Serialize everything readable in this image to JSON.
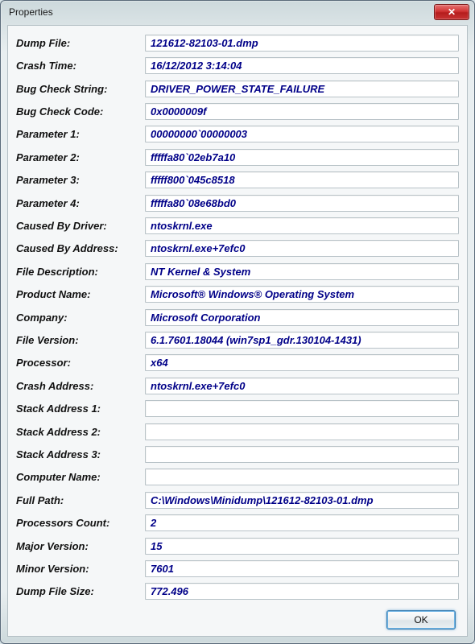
{
  "window": {
    "title": "Properties"
  },
  "fields": [
    {
      "label": "Dump File:",
      "value": "121612-82103-01.dmp"
    },
    {
      "label": "Crash Time:",
      "value": "16/12/2012 3:14:04"
    },
    {
      "label": "Bug Check String:",
      "value": "DRIVER_POWER_STATE_FAILURE"
    },
    {
      "label": "Bug Check Code:",
      "value": "0x0000009f"
    },
    {
      "label": "Parameter 1:",
      "value": "00000000`00000003"
    },
    {
      "label": "Parameter 2:",
      "value": "fffffa80`02eb7a10"
    },
    {
      "label": "Parameter 3:",
      "value": "fffff800`045c8518"
    },
    {
      "label": "Parameter 4:",
      "value": "fffffa80`08e68bd0"
    },
    {
      "label": "Caused By Driver:",
      "value": "ntoskrnl.exe"
    },
    {
      "label": "Caused By Address:",
      "value": "ntoskrnl.exe+7efc0"
    },
    {
      "label": "File Description:",
      "value": "NT Kernel & System"
    },
    {
      "label": "Product Name:",
      "value": "Microsoft® Windows® Operating System"
    },
    {
      "label": "Company:",
      "value": "Microsoft Corporation"
    },
    {
      "label": "File Version:",
      "value": "6.1.7601.18044 (win7sp1_gdr.130104-1431)"
    },
    {
      "label": "Processor:",
      "value": "x64"
    },
    {
      "label": "Crash Address:",
      "value": "ntoskrnl.exe+7efc0"
    },
    {
      "label": "Stack Address 1:",
      "value": ""
    },
    {
      "label": "Stack Address 2:",
      "value": ""
    },
    {
      "label": "Stack Address 3:",
      "value": ""
    },
    {
      "label": "Computer Name:",
      "value": ""
    },
    {
      "label": "Full Path:",
      "value": "C:\\Windows\\Minidump\\121612-82103-01.dmp"
    },
    {
      "label": "Processors Count:",
      "value": "2"
    },
    {
      "label": "Major Version:",
      "value": "15"
    },
    {
      "label": "Minor Version:",
      "value": "7601"
    },
    {
      "label": "Dump File Size:",
      "value": "772.496"
    }
  ],
  "buttons": {
    "ok": "OK",
    "close": "✕"
  }
}
